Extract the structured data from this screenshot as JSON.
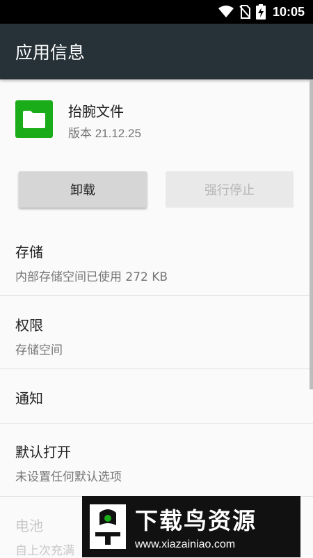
{
  "status_bar": {
    "time": "10:05",
    "icons": [
      "wifi-icon",
      "no-sim-icon",
      "battery-charging-icon"
    ]
  },
  "toolbar": {
    "title": "应用信息"
  },
  "app": {
    "name": "抬腕文件",
    "version": "版本 21.12.25",
    "icon": "folder-icon",
    "icon_color": "#1aad19"
  },
  "actions": {
    "uninstall": "卸载",
    "force_stop": "强行停止"
  },
  "sections": {
    "storage": {
      "title": "存储",
      "subtitle": "内部存储空间已使用 272 KB"
    },
    "permissions": {
      "title": "权限",
      "subtitle": "存储空间"
    },
    "notifications": {
      "title": "通知"
    },
    "open_by_default": {
      "title": "默认打开",
      "subtitle": "未设置任何默认选项"
    },
    "battery": {
      "title": "电池",
      "subtitle": "自上次充满"
    }
  },
  "watermark": {
    "title": "下载鸟资源",
    "url": "www.xiazainiao.com"
  },
  "colors": {
    "toolbar": "#263238",
    "status_bar": "#000000",
    "background": "#fafafa"
  }
}
